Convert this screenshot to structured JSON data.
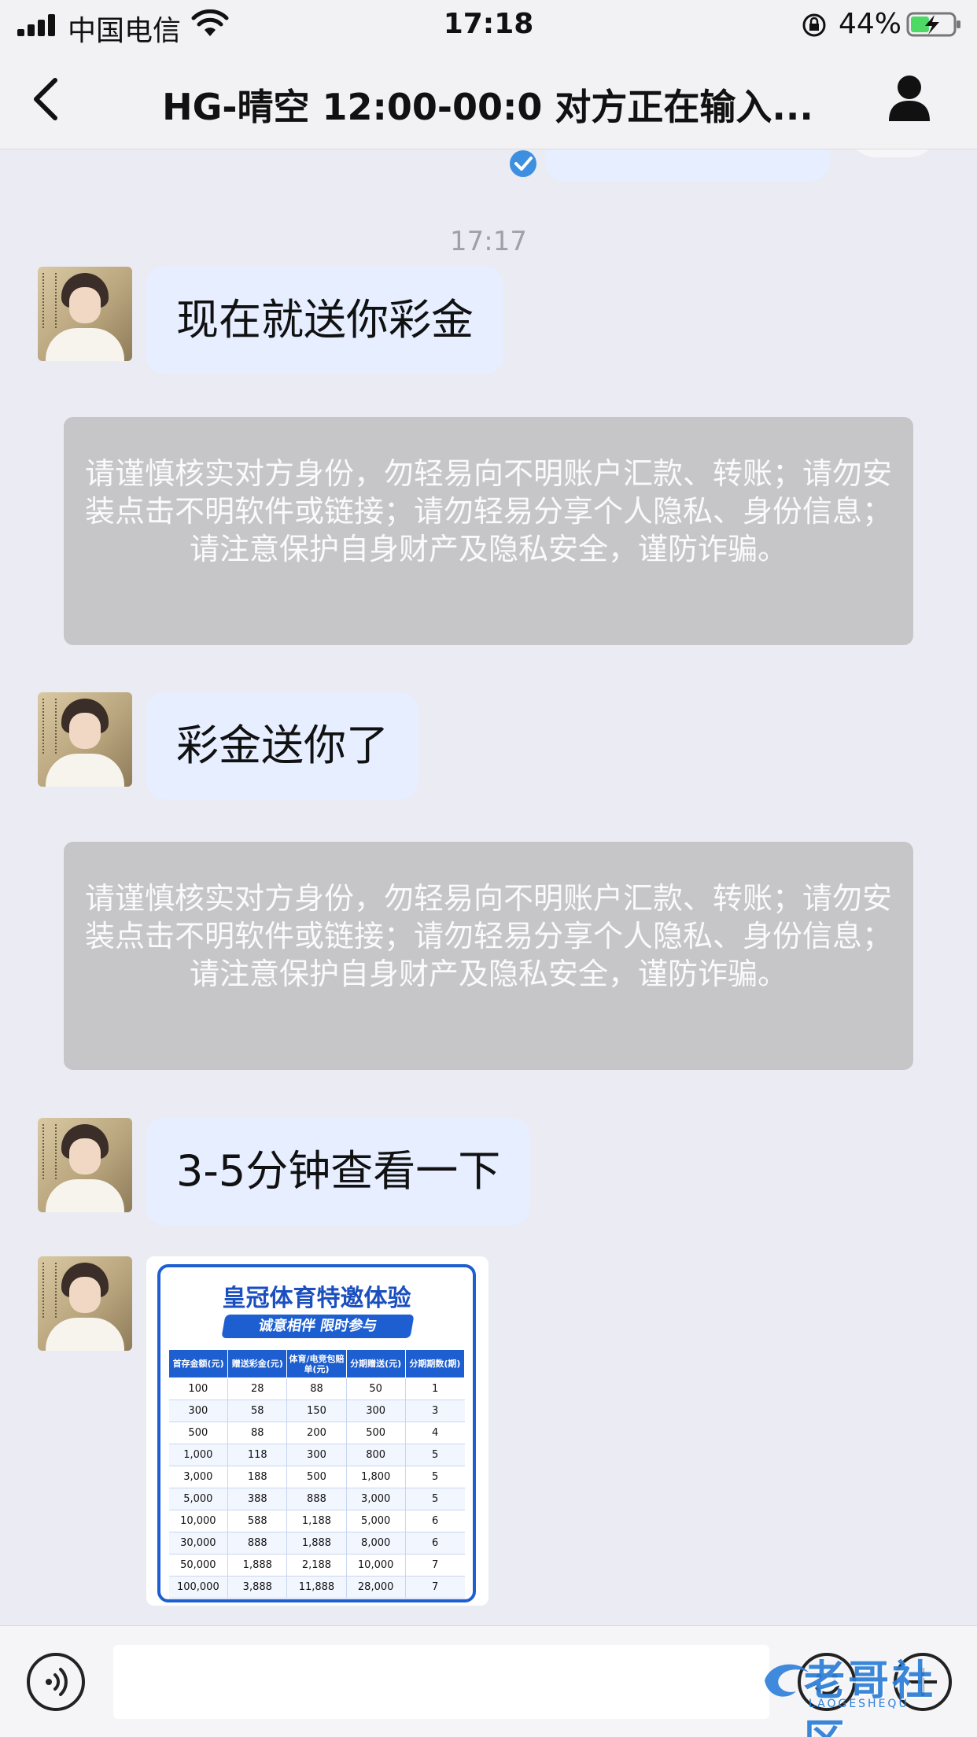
{
  "status_bar": {
    "carrier": "中国电信",
    "time": "17:18",
    "battery_percent": "44%",
    "battery_level": 0.44
  },
  "nav": {
    "title": "HG-晴空 12:00-00:0 对方正在输入..."
  },
  "chat": {
    "timestamp": "17:17",
    "messages": [
      {
        "type": "text",
        "text": "现在就送你彩金"
      },
      {
        "type": "notice",
        "text": "请谨慎核实对方身份，勿轻易向不明账户汇款、转账；请勿安装点击不明软件或链接；请勿轻易分享个人隐私、身份信息；请注意保护自身财产及隐私安全，谨防诈骗。"
      },
      {
        "type": "text",
        "text": "彩金送你了"
      },
      {
        "type": "notice",
        "text": "请谨慎核实对方身份，勿轻易向不明账户汇款、转账；请勿安装点击不明软件或链接；请勿轻易分享个人隐私、身份信息；请注意保护自身财产及隐私安全，谨防诈骗。"
      },
      {
        "type": "text",
        "text": "3-5分钟查看一下"
      }
    ],
    "promo_image": {
      "title": "皇冠体育特邀体验",
      "banner": "诚意相伴  限时参与",
      "headers": [
        "首存金额(元)",
        "赠送彩金(元)",
        "体育/电竞包赔单(元)",
        "分期赠送(元)",
        "分期期数(期)"
      ],
      "rows": [
        [
          "100",
          "28",
          "88",
          "50",
          "1"
        ],
        [
          "300",
          "58",
          "150",
          "300",
          "3"
        ],
        [
          "500",
          "88",
          "200",
          "500",
          "4"
        ],
        [
          "1,000",
          "118",
          "300",
          "800",
          "5"
        ],
        [
          "3,000",
          "188",
          "500",
          "1,800",
          "5"
        ],
        [
          "5,000",
          "388",
          "888",
          "3,000",
          "5"
        ],
        [
          "10,000",
          "588",
          "1,188",
          "5,000",
          "6"
        ],
        [
          "30,000",
          "888",
          "1,888",
          "8,000",
          "6"
        ],
        [
          "50,000",
          "1,888",
          "2,188",
          "10,000",
          "7"
        ],
        [
          "100,000",
          "3,888",
          "11,888",
          "28,000",
          "7"
        ]
      ]
    }
  },
  "input": {
    "value": "",
    "placeholder": ""
  },
  "watermark": {
    "text": "老哥社区",
    "sub": "LAOGESHEQU"
  },
  "colors": {
    "background": "#ebebf3",
    "bubble": "#e6eeff",
    "notice": "#c6c6c9",
    "promo_blue": "#1d5fd1",
    "check_blue": "#3d8fe0",
    "battery_green": "#4cd964"
  },
  "icons": {
    "back": "chevron-left-icon",
    "profile": "person-icon",
    "voice": "voice-icon",
    "emoji": "emoji-icon",
    "plus": "plus-icon",
    "read": "check-circle-icon"
  }
}
